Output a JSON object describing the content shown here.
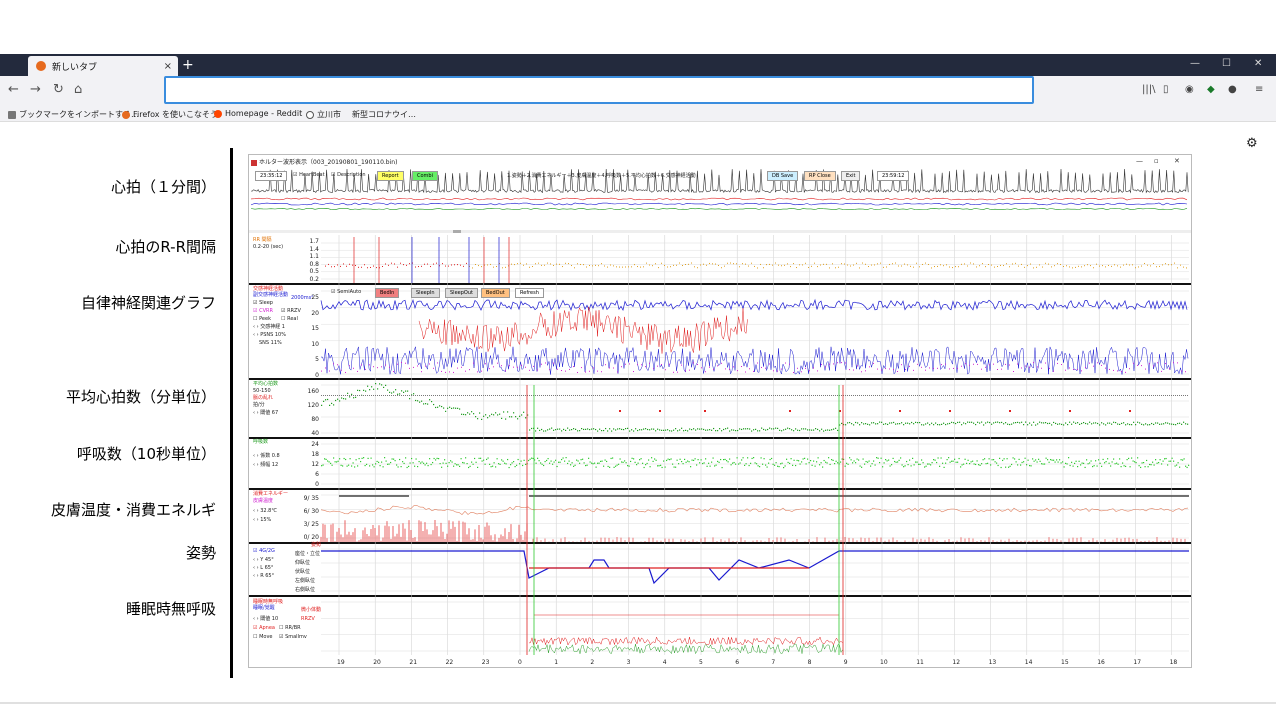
{
  "browser": {
    "tab_title": "新しいタブ",
    "tab_close": "×",
    "new_tab": "+",
    "window_controls": [
      "—",
      "☐",
      "✕"
    ],
    "url_value": "",
    "bookmarks": [
      "ブックマークをインポートする…",
      "Firefox を使いこなそう",
      "Homepage - Reddit",
      "立川市",
      "新型コロナウイ…"
    ],
    "nav_icons": [
      "back-icon",
      "forward-icon",
      "reload-icon",
      "home-icon"
    ],
    "toolbar_icons": [
      "library-icon",
      "sidebar-icon",
      "account-icon",
      "shield-icon",
      "extension-icon",
      "menu-icon"
    ]
  },
  "slide": {
    "labels": [
      "心拍（１分間）",
      "心拍のR-R間隔",
      "自律神経関連グラフ",
      "平均心拍数（分単位）",
      "呼吸数（10秒単位）",
      "皮膚温度・消費エネルギ",
      "姿勢",
      "睡眠時無呼吸"
    ]
  },
  "app": {
    "title": "ホルター波形表示（003_20190801_190110.bin)",
    "controls": [
      "—",
      "▫",
      "✕"
    ],
    "toolbar": {
      "time_start": "23:35:12",
      "heartbeat_label": "HeartBeat",
      "description_label": "Description",
      "report_button": "Report",
      "combi_button": "Combi",
      "legend": "1.姿勢＋2.消費エネルギー＋3.皮膚温度＋4.呼吸数＋5.平均心拍数＋6.交感神経活動",
      "db_save_button": "DB Save",
      "rp_close_button": "RP Close",
      "exit_button": "Exit",
      "time_end": "23:59:12"
    },
    "rr_panel": {
      "title": "RR 間隔",
      "range": "0.2-20 (sec)",
      "yticks": [
        "1.7",
        "1.4",
        "1.1",
        "0.8",
        "0.5",
        "0.2"
      ]
    },
    "ans_panel": {
      "title1": "交感神経活動",
      "title2": "副交感神経活動",
      "unit": "2000ms²",
      "semiauto_label": "SemiAuto",
      "buttons": [
        "BedIn",
        "SleepIn",
        "SleepOut",
        "BedOut",
        "Refresh"
      ],
      "checks": [
        "Sleep",
        "CVRR",
        "RRZV",
        "Peek",
        "Real"
      ],
      "threshold": "交感神経 1",
      "psns": "PSNS 10%",
      "sns": "SNS 11%",
      "yticks": [
        "25",
        "20",
        "15",
        "10",
        "5",
        "0"
      ]
    },
    "hr_panel": {
      "title": "平均心拍数",
      "range": "50-150",
      "sub": "脈の乱れ",
      "unit": "拍/分",
      "threshold": "閾値 67",
      "yticks": [
        "160",
        "120",
        "80",
        "40"
      ]
    },
    "resp_panel": {
      "title": "呼吸数",
      "coef": "係数 0.8",
      "freq": "頻幅 12",
      "yticks": [
        "24",
        "18",
        "12",
        "6",
        "0"
      ]
    },
    "temp_panel": {
      "title1": "消費エネルギー",
      "title2": "皮膚温度",
      "temp": "32.8℃",
      "pct": "15%",
      "yticks": [
        "9/ 35",
        "6/ 30",
        "3/ 25",
        "0/ 20"
      ]
    },
    "posture_panel": {
      "title": "姿勢",
      "mode": "4G/2G",
      "y": "Y 45°",
      "l": "L 65°",
      "r": "R 65°",
      "states": [
        "座位・立位",
        "仰臥位",
        "伏臥位",
        "左側臥位",
        "右側臥位"
      ]
    },
    "apnea_panel": {
      "title1": "睡眠時無呼吸",
      "title2": "睡眠/覚醒",
      "sub": "微小体動",
      "threshold": "閾値 10",
      "rrzv": "RRZV",
      "checks": [
        "Apnea",
        "RR/BR",
        "Move",
        "Smallmv"
      ]
    },
    "xticks": [
      "19",
      "20",
      "21",
      "22",
      "23",
      "0",
      "1",
      "2",
      "3",
      "4",
      "5",
      "6",
      "7",
      "8",
      "9",
      "10",
      "11",
      "12",
      "13",
      "14",
      "15",
      "16",
      "17",
      "18"
    ]
  },
  "colors": {
    "accent": "#3a8dde",
    "chrome_dark": "#232a3d",
    "red": "#e02020",
    "blue": "#1a1ad0",
    "green": "#1c9a1c",
    "orange": "#e0a020"
  }
}
